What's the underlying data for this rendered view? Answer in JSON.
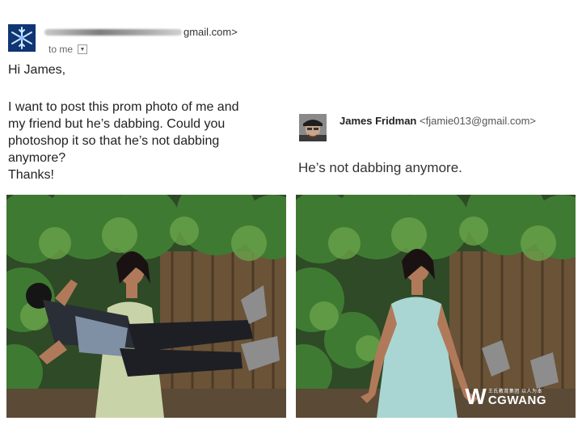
{
  "left_email": {
    "sender_suffix": "gmail.com>",
    "recipient": "to me",
    "greeting": "Hi James,",
    "body_lines": [
      "I want to post this prom photo of me and",
      "my friend but he’s dabbing. Could you",
      "photoshop it so that he’s not dabbing",
      "anymore?",
      "Thanks!"
    ]
  },
  "right_email": {
    "sender_name": "James Fridman",
    "sender_email": "<fjamie013@gmail.com>",
    "reply_text": "He’s not dabbing anymore."
  },
  "photos": {
    "before": "prom photo with friend dabbing",
    "after": "edited prom photo"
  },
  "watermark": {
    "small_text": "王氏教育集团 以人为本",
    "brand": "CGWANG",
    "mark": "W"
  },
  "colors": {
    "foliage": "#3b6b2e",
    "dress": "#a9d6d2",
    "background": "#ffffff"
  }
}
